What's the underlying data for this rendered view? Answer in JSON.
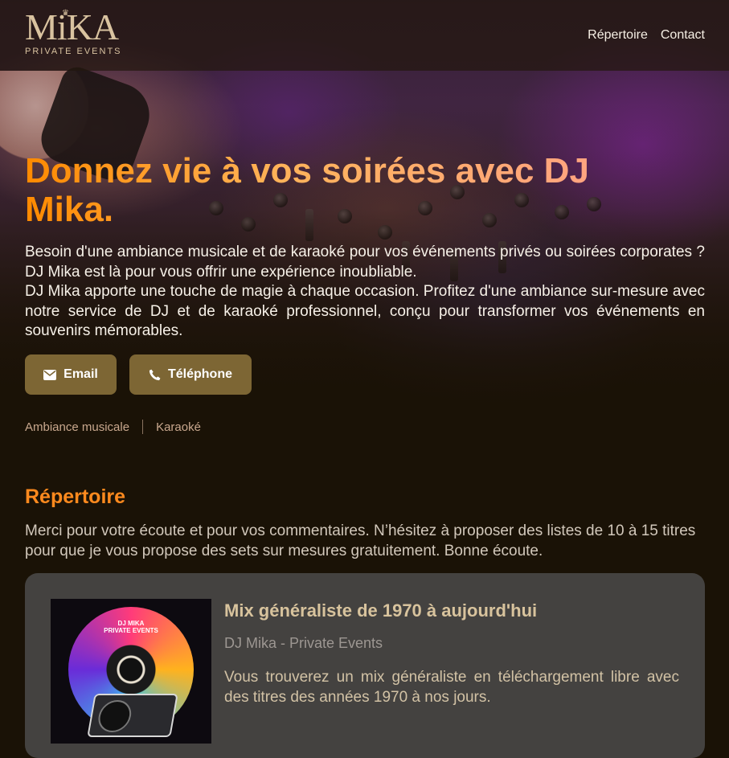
{
  "brand": {
    "logo_text": "MiKA",
    "tagline": "PRIVATE EVENTS"
  },
  "nav": {
    "items": [
      {
        "label": "Répertoire"
      },
      {
        "label": "Contact"
      }
    ]
  },
  "hero": {
    "title": "Donnez vie à vos soirées avec DJ Mika.",
    "paragraph_1": "Besoin d'une ambiance musicale et de karaoké pour vos événements privés ou soirées corporates ? DJ Mika est là pour vous offrir une expérience inoubliable.",
    "paragraph_2": "DJ Mika apporte une touche de magie à chaque occasion. Profitez d'une ambiance sur-mesure avec notre service de DJ et de karaoké professionnel, conçu pour transformer vos événements en souvenirs mémorables.",
    "buttons": {
      "email": {
        "label": "Email",
        "icon": "envelope-icon"
      },
      "phone": {
        "label": "Téléphone",
        "icon": "phone-icon"
      }
    },
    "tags": [
      "Ambiance musicale",
      "Karaoké"
    ]
  },
  "repertoire": {
    "title": "Répertoire",
    "intro": "Merci pour votre écoute et pour vos commentaires. N’hésitez à proposer des listes de 10 à 15 titres pour que je vous propose des sets sur mesures gratuitement. Bonne écoute.",
    "items": [
      {
        "title": "Mix généraliste de 1970 à aujourd'hui",
        "author": "DJ Mika - Private Events",
        "description": "Vous trouverez un mix généraliste en téléchargement libre avec des titres des années 1970 à nos jours.",
        "cover_label": "DJ MIKA\nPRIVATE EVENTS"
      }
    ]
  },
  "colors": {
    "accent": "#ff8a1e",
    "button_bg": "#7d6634",
    "card_bg": "#444240",
    "page_bg": "#1a1206",
    "logo_gold": "#d9c3a0"
  }
}
